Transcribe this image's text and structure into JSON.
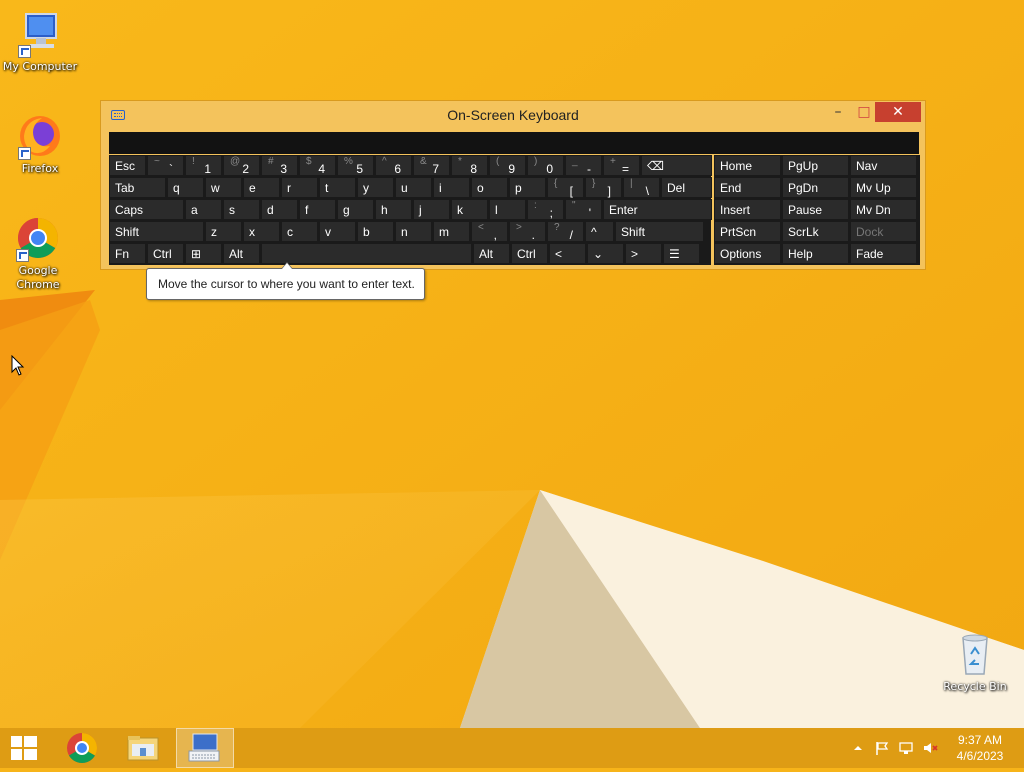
{
  "desktop": {
    "icons": [
      {
        "label": "My Computer"
      },
      {
        "label": "Firefox"
      },
      {
        "label": "Google Chrome"
      },
      {
        "label": "Recycle Bin"
      }
    ]
  },
  "window": {
    "title": "On-Screen Keyboard",
    "minimize": "–",
    "maximize": "□",
    "close": "✕"
  },
  "keyboard": {
    "row1": [
      {
        "p": "Esc"
      },
      {
        "s": "~",
        "p": "`"
      },
      {
        "s": "!",
        "p": "1"
      },
      {
        "s": "@",
        "p": "2"
      },
      {
        "s": "#",
        "p": "3"
      },
      {
        "s": "$",
        "p": "4"
      },
      {
        "s": "%",
        "p": "5"
      },
      {
        "s": "^",
        "p": "6"
      },
      {
        "s": "&",
        "p": "7"
      },
      {
        "s": "*",
        "p": "8"
      },
      {
        "s": "(",
        "p": "9"
      },
      {
        "s": ")",
        "p": "0"
      },
      {
        "s": "_",
        "p": "-"
      },
      {
        "s": "+",
        "p": "="
      },
      {
        "p": "⌫"
      }
    ],
    "row2": [
      {
        "p": "Tab"
      },
      {
        "p": "q"
      },
      {
        "p": "w"
      },
      {
        "p": "e"
      },
      {
        "p": "r"
      },
      {
        "p": "t"
      },
      {
        "p": "y"
      },
      {
        "p": "u"
      },
      {
        "p": "i"
      },
      {
        "p": "o"
      },
      {
        "p": "p"
      },
      {
        "s": "{",
        "p": "["
      },
      {
        "s": "}",
        "p": "]"
      },
      {
        "s": "|",
        "p": "\\"
      },
      {
        "p": "Del"
      }
    ],
    "row3": [
      {
        "p": "Caps"
      },
      {
        "p": "a"
      },
      {
        "p": "s"
      },
      {
        "p": "d"
      },
      {
        "p": "f"
      },
      {
        "p": "g"
      },
      {
        "p": "h"
      },
      {
        "p": "j"
      },
      {
        "p": "k"
      },
      {
        "p": "l"
      },
      {
        "s": ":",
        "p": ";"
      },
      {
        "s": "\"",
        "p": "'"
      },
      {
        "p": "Enter"
      }
    ],
    "row4": [
      {
        "p": "Shift"
      },
      {
        "p": "z"
      },
      {
        "p": "x"
      },
      {
        "p": "c"
      },
      {
        "p": "v"
      },
      {
        "p": "b"
      },
      {
        "p": "n"
      },
      {
        "p": "m"
      },
      {
        "s": "<",
        "p": ","
      },
      {
        "s": ">",
        "p": "."
      },
      {
        "s": "?",
        "p": "/"
      },
      {
        "p": "^"
      },
      {
        "p": "Shift"
      }
    ],
    "row5": [
      {
        "p": "Fn"
      },
      {
        "p": "Ctrl"
      },
      {
        "p": "⊞"
      },
      {
        "p": "Alt"
      },
      {
        "p": ""
      },
      {
        "p": "Alt"
      },
      {
        "p": "Ctrl"
      },
      {
        "p": "<"
      },
      {
        "p": "⌄"
      },
      {
        "p": ">"
      },
      {
        "p": "☰"
      }
    ],
    "nav": [
      [
        "Home",
        "PgUp",
        "Nav"
      ],
      [
        "End",
        "PgDn",
        "Mv Up"
      ],
      [
        "Insert",
        "Pause",
        "Mv Dn"
      ],
      [
        "PrtScn",
        "ScrLk",
        "Dock"
      ],
      [
        "Options",
        "Help",
        "Fade"
      ]
    ]
  },
  "tooltip": {
    "text": "Move the cursor to where you want to enter text."
  },
  "taskbar": {
    "time": "9:37 AM",
    "date": "4/6/2023"
  },
  "colors": {
    "wallpaper": "#f7b419",
    "window_frame": "#f4c35c",
    "close_button": "#c7402f",
    "key_bg": "#2b2b2b"
  }
}
